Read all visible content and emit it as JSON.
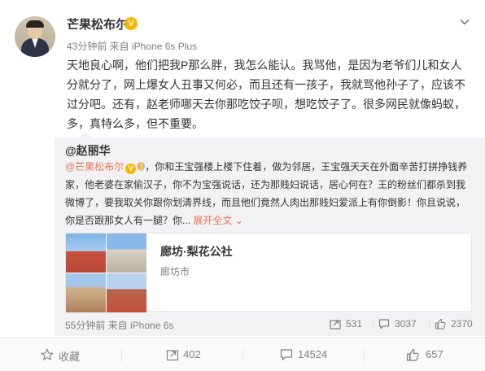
{
  "post": {
    "username": "芒果松布尔",
    "verified_badge": "V",
    "meta": "43分钟前 来自 iPhone 6s Plus",
    "text": "天地良心啊，他们把我P那么胖，我怎么能认。我骂他，是因为老爷们儿和女人分就分了，网上爆女人丑事又何必，而且还有一孩子，我就骂他孙子了，应该不过分吧。还有，赵老师哪天去你那吃饺子呗，想吃饺子了。很多网民就像蚂蚁，多，真特么多，但不重要。"
  },
  "repost": {
    "author": "@赵丽华",
    "mention": "@芒果松布尔",
    "text": "，你和王宝强楼上楼下住着，做为邻居，王宝强天天在外面辛苦打拼挣钱养家，他老婆在家偷汉子，你不为宝强说话，还为那贱妇说话，居心何在？王的粉丝们都杀到我微博了，要我取关你跟你划清界线，而且他们竟然人肉出那贱妇爱派上有你倒影！你且说说，你是否跟那女人有一腿？你...",
    "expand_label": "展开全文",
    "link_card": {
      "title": "廊坊·梨花公社",
      "subtitle": "廊坊市"
    },
    "meta": "55分钟前 来自 iPhone 6s",
    "stats": {
      "reposts": "531",
      "comments": "3037",
      "likes": "2370"
    }
  },
  "actions": {
    "favorite_label": "收藏",
    "repost_count": "402",
    "comment_count": "14524",
    "like_count": "657"
  },
  "colors": {
    "accent": "#eb7350",
    "badge": "#f7b500",
    "muted": "#808080",
    "repost_bg": "#f2f2f5"
  },
  "icons": [
    "chevron-down-icon",
    "verified-badge-icon",
    "repost-icon",
    "comment-icon",
    "like-icon",
    "star-icon",
    "balloon-icon"
  ]
}
